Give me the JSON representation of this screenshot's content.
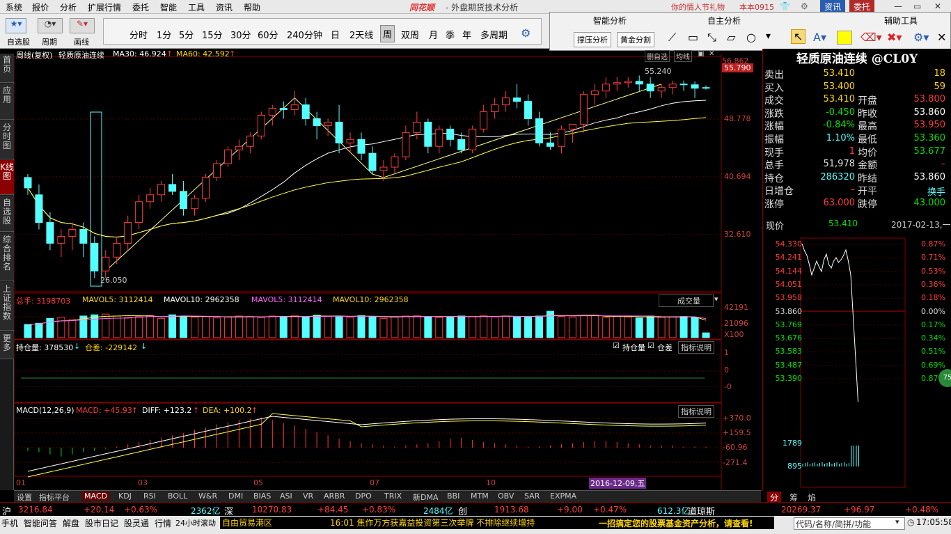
{
  "menubar": {
    "items": [
      "系统",
      "报价",
      "分析",
      "扩展行情",
      "委托",
      "智能",
      "工具",
      "资讯",
      "帮助"
    ],
    "brand": "同花顺",
    "app_title": "- 外盘期货技术分析",
    "promo": "你的情人节礼物",
    "user": "本本0915",
    "news_btn": "资讯",
    "trade_btn": "委托"
  },
  "toolbar": {
    "left_labels": [
      "自选股",
      "周期",
      "画线"
    ],
    "periods": [
      "分时",
      "1分",
      "5分",
      "15分",
      "30分",
      "60分",
      "240分钟",
      "日",
      "2天线",
      "周",
      "双周",
      "月",
      "季",
      "年",
      "多周期"
    ],
    "active_period": "周"
  },
  "tool_panel": {
    "headers": [
      "智能分析",
      "自主分析",
      "辅助工具"
    ],
    "buttons": [
      "撑压分析",
      "黄金分割"
    ]
  },
  "left_tabs": [
    "首页",
    "应用",
    "分时图",
    "K线图",
    "自选股",
    "综合排名",
    "上证指数",
    "更多"
  ],
  "active_left_tab": "K线图",
  "main_chart": {
    "header_prefix": "周线(复权)",
    "symbol": "轻质原油连续",
    "ma30_label": "MA30: 46.924",
    "ma60_label": "MA60: 42.592",
    "top_buttons": [
      "删自选",
      "均线"
    ],
    "right_prices": [
      "56.862",
      "55.790",
      "48.778",
      "40.694",
      "32.610"
    ],
    "high_marker": "55.240",
    "low_marker": "26.050"
  },
  "volume_panel": {
    "total_label": "总手: 3198703",
    "mavol5": "MAVOL5: 3112414",
    "mavol10": "MAVOL10: 2962358",
    "mavol5_b": "MAVOL5: 3112414",
    "mavol10_b": "MAVOL10: 2962358",
    "selector": "成交量",
    "scale": [
      "42191",
      "21096",
      "X100"
    ]
  },
  "oi_panel": {
    "label": "持仓量: 378530",
    "diff_label": "仓差: -229142",
    "check1": "持仓量",
    "check2": "仓差",
    "help_btn": "指标说明",
    "scale": [
      "1",
      "0",
      "-0"
    ]
  },
  "macd_panel": {
    "label": "MACD(12,26,9)",
    "macd": "MACD: +45.93",
    "diff": "DIFF: +123.2",
    "dea": "DEA: +100.2",
    "help_btn": "指标说明",
    "scale": [
      "+370.0",
      "+159.5",
      "-60.96",
      "-271.4"
    ]
  },
  "x_axis": [
    "01",
    "03",
    "05",
    "07",
    "10"
  ],
  "cursor_date": "2016-12-09,五",
  "bottom_tabs": [
    "设置",
    "指标平台",
    "MACD",
    "KDJ",
    "RSI",
    "BOLL",
    "W&R",
    "DMI",
    "BIAS",
    "ASI",
    "VR",
    "ARBR",
    "DPO",
    "TRIX",
    "新DMA",
    "BBI",
    "MTM",
    "OBV",
    "SAR",
    "EXPMA"
  ],
  "active_bottom_tab": "MACD",
  "quote": {
    "title": "轻质原油连续 @CL0Y",
    "rows": [
      {
        "l1": "卖出",
        "v1": "53.410",
        "l2": "",
        "v2": "18"
      },
      {
        "l1": "买入",
        "v1": "53.400",
        "l2": "",
        "v2": "59"
      },
      {
        "l1": "成交",
        "v1": "53.410",
        "l2": "开盘",
        "v2": "53.800"
      },
      {
        "l1": "涨跌",
        "v1": "-0.450",
        "l2": "昨收",
        "v2": "53.860"
      },
      {
        "l1": "涨幅",
        "v1": "-0.84%",
        "l2": "最高",
        "v2": "53.950"
      },
      {
        "l1": "振幅",
        "v1": "1.10%",
        "l2": "最低",
        "v2": "53.360"
      },
      {
        "l1": "现手",
        "v1": "1",
        "l2": "均价",
        "v2": "53.677"
      },
      {
        "l1": "总手",
        "v1": "51,978",
        "l2": "金额",
        "v2": "–"
      },
      {
        "l1": "持仓",
        "v1": "286320",
        "l2": "昨结",
        "v2": "53.860"
      },
      {
        "l1": "日增仓",
        "v1": "–",
        "l2": "开平",
        "v2": "换手"
      },
      {
        "l1": "涨停",
        "v1": "63.000",
        "l2": "跌停",
        "v2": "43.000"
      }
    ],
    "now_label": "现价",
    "now_price": "53.410",
    "now_date": "2017-02-13,一",
    "left_scale": [
      "54.330",
      "54.241",
      "54.144",
      "54.051",
      "53.958",
      "53.860",
      "53.769",
      "53.676",
      "53.583",
      "53.487",
      "53.390",
      "1789",
      "895"
    ],
    "right_scale": [
      "0.87%",
      "0.71%",
      "0.53%",
      "0.36%",
      "0.18%",
      "0.00%",
      "0.17%",
      "0.34%",
      "0.51%",
      "0.69%",
      "0.87%"
    ],
    "badge": "75",
    "tabs": [
      "分",
      "筹",
      "焰"
    ]
  },
  "ticker": {
    "sh_label": "沪",
    "sh_val": "3216.84",
    "sh_chg": "+20.14",
    "sh_pct": "+0.63%",
    "sh_amt": "2362亿",
    "sz_label": "深",
    "sz_val": "10270.83",
    "sz_chg": "+84.45",
    "sz_pct": "+0.83%",
    "sz_amt": "2484亿",
    "cy_label": "创",
    "cy_val": "1913.68",
    "cy_chg": "+9.00",
    "cy_pct": "+0.47%",
    "cy_amt": "612.3亿",
    "dj_label": "道琼斯",
    "dj_val": "20269.37",
    "dj_chg": "+96.97",
    "dj_pct": "+0.48%"
  },
  "status": {
    "items": [
      "手机",
      "智能问答",
      "解盘",
      "股市日记",
      "股灵通",
      "行情",
      "24小时滚动"
    ],
    "zone": "自由贸易港区",
    "news": "16:01 焦作万方获嘉益投资第三次举牌 不排除继续增持",
    "ad": "一招搞定您的股票基金资产分析，请查看!",
    "search_ph": "代码/名称/简拼/功能",
    "time": "17:05:58"
  },
  "chart_data": {
    "type": "candlestick",
    "ylim": [
      24,
      58
    ],
    "candles": [
      [
        40.5,
        41,
        38,
        39
      ],
      [
        38,
        39.5,
        33,
        34
      ],
      [
        34,
        35.5,
        30,
        31
      ],
      [
        31,
        33,
        29,
        32
      ],
      [
        32,
        34,
        30,
        33
      ],
      [
        33,
        34,
        29,
        31
      ],
      [
        31,
        32,
        26,
        27
      ],
      [
        27,
        30,
        26,
        29
      ],
      [
        29,
        32,
        28,
        31
      ],
      [
        31,
        35,
        30,
        34
      ],
      [
        34,
        38,
        33,
        37
      ],
      [
        37,
        39,
        36,
        38
      ],
      [
        38,
        40,
        37,
        39.5
      ],
      [
        39.5,
        41,
        38,
        38.5
      ],
      [
        38.5,
        40,
        35,
        36
      ],
      [
        36,
        38,
        35,
        37.5
      ],
      [
        37.5,
        41,
        37,
        40.5
      ],
      [
        40.5,
        43,
        40,
        42.5
      ],
      [
        42.5,
        45,
        42,
        44.5
      ],
      [
        44.5,
        46,
        43,
        45
      ],
      [
        45,
        47,
        44,
        46.5
      ],
      [
        46.5,
        50,
        46,
        49.5
      ],
      [
        49.5,
        51,
        48,
        50.5
      ],
      [
        50.5,
        51.5,
        49,
        50.3
      ],
      [
        50.3,
        53,
        49.5,
        51
      ],
      [
        51,
        52,
        48,
        49
      ],
      [
        49,
        50,
        46,
        48
      ],
      [
        48,
        49,
        46.5,
        48.5
      ],
      [
        48.5,
        51,
        44,
        45.5
      ],
      [
        45.5,
        47,
        44,
        46
      ],
      [
        46,
        47,
        43,
        44
      ],
      [
        44,
        45,
        41,
        41.5
      ],
      [
        41.5,
        43,
        40,
        42
      ],
      [
        42,
        44,
        41,
        43.5
      ],
      [
        43.5,
        48,
        43,
        47
      ],
      [
        47,
        50,
        46,
        48.5
      ],
      [
        48.5,
        49,
        44,
        45
      ],
      [
        45,
        48,
        44,
        47.5
      ],
      [
        47.5,
        48,
        45,
        46
      ],
      [
        46,
        47,
        44,
        44.5
      ],
      [
        44.5,
        48,
        44,
        47.5
      ],
      [
        47.5,
        51,
        47,
        50
      ],
      [
        50,
        52,
        49,
        51
      ],
      [
        51,
        53,
        50,
        52
      ],
      [
        52,
        54,
        50.5,
        51.5
      ],
      [
        51.5,
        52.5,
        48,
        49
      ],
      [
        49,
        50,
        45,
        45.5
      ],
      [
        45.5,
        47,
        44.5,
        45
      ],
      [
        45,
        48,
        44,
        47.5
      ],
      [
        47.5,
        48,
        45.5,
        48.2
      ],
      [
        48.2,
        53,
        47,
        52.5
      ],
      [
        52.5,
        54,
        51,
        53
      ],
      [
        53,
        55,
        52,
        54
      ],
      [
        54,
        55,
        53,
        54.2
      ],
      [
        54.2,
        55,
        53.5,
        54.4
      ],
      [
        54.4,
        55.24,
        53,
        54
      ],
      [
        54,
        55,
        52,
        53
      ],
      [
        53,
        54,
        52,
        53.5
      ],
      [
        53.5,
        54.5,
        52.5,
        54
      ],
      [
        54,
        54.5,
        53,
        53.9
      ],
      [
        53.9,
        54.4,
        52,
        53.4
      ],
      [
        53.5,
        53.8,
        53.2,
        53.4
      ]
    ],
    "volumes": [
      55,
      60,
      80,
      85,
      75,
      90,
      95,
      98,
      90,
      85,
      88,
      92,
      80,
      95,
      90,
      85,
      88,
      82,
      86,
      90,
      88,
      84,
      90,
      88,
      92,
      86,
      94,
      88,
      90,
      85,
      92,
      88,
      80,
      86,
      90,
      92,
      88,
      84,
      86,
      90,
      88,
      92,
      86,
      90,
      88,
      85,
      90,
      110,
      88,
      86,
      92,
      94,
      84,
      88,
      86,
      82,
      90,
      85,
      86,
      88,
      84,
      20
    ],
    "macd_hist": [
      -3,
      -4,
      -6,
      -8,
      -6,
      -4,
      -3,
      -1,
      1,
      3,
      5,
      7,
      9,
      11,
      13,
      16,
      18,
      21,
      23,
      25,
      26,
      27,
      25,
      22,
      20,
      17,
      14,
      11,
      8,
      6,
      4,
      3,
      2,
      1,
      2,
      3,
      4,
      6,
      8,
      9,
      7,
      5,
      4,
      3,
      2,
      1,
      1,
      2,
      3,
      4,
      5,
      6,
      6,
      5,
      4,
      3,
      2,
      2,
      2,
      1,
      1,
      1
    ]
  }
}
